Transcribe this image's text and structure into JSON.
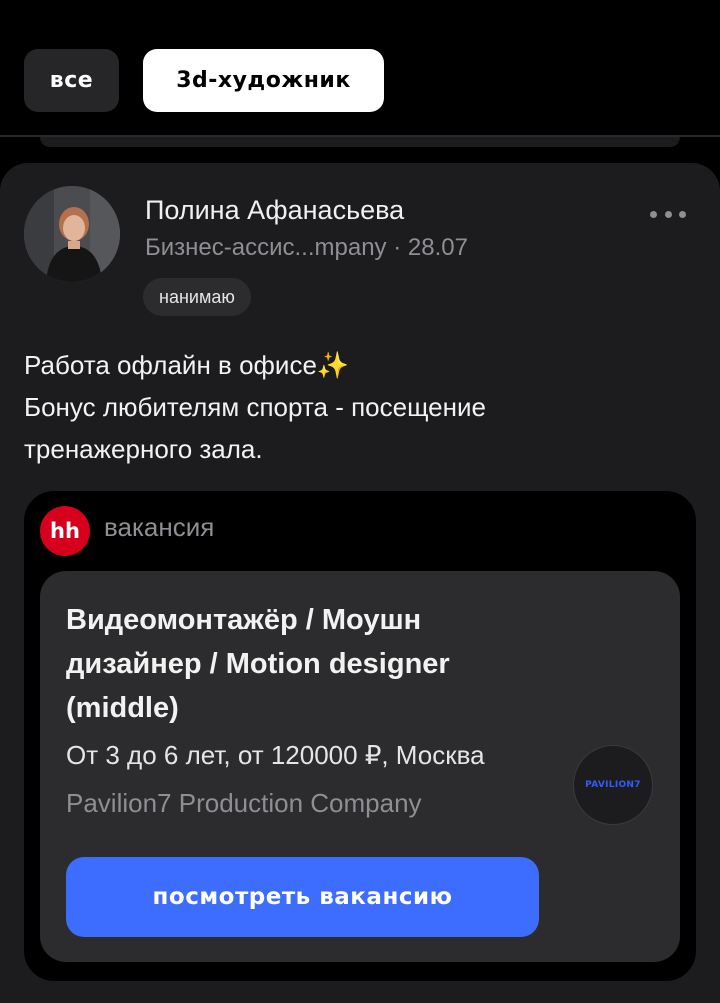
{
  "filters": {
    "chips": [
      {
        "label": "все"
      },
      {
        "label": "3d-художник"
      }
    ]
  },
  "post": {
    "author": {
      "name": "Полина Афанасьева",
      "meta": "Бизнес-ассис...mpany · 28.07",
      "badge": "нанимаю"
    },
    "text_lines": [
      "Работа офлайн в офисе",
      "Бонус любителям спорта - посещение",
      "тренажерного зала."
    ],
    "text_emoji": "✨",
    "embed": {
      "source_logo": "hh",
      "label": "вакансия",
      "vacancy": {
        "title": "Видеомонтажёр / Моушн дизайнер / Motion designer (middle)",
        "terms": "От 3 до 6 лет, от 120000 ₽, Москва",
        "company": "Pavilion7 Production Company",
        "company_logo_text": "PAVILION7",
        "button_label": "посмотреть вакансию"
      }
    }
  },
  "colors": {
    "background": "#000000",
    "card": "#1c1c1e",
    "accent_button": "#3d6dff",
    "hh_red": "#d6001c"
  }
}
